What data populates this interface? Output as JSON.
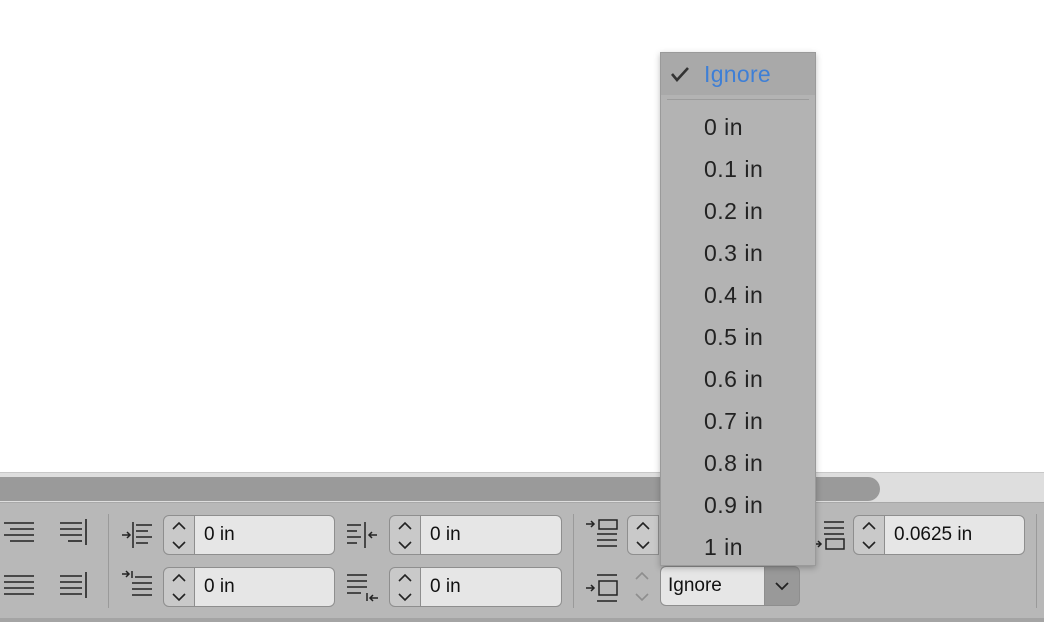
{
  "paragraph_panel": {
    "left_indent": {
      "value": "0 in"
    },
    "first_line_indent": {
      "value": "0 in"
    },
    "right_indent": {
      "value": "0 in"
    },
    "last_line_indent": {
      "value": "0 in"
    },
    "space_before": {
      "value": ""
    },
    "space_after": {
      "value": "0.0625 in"
    },
    "align_to_grid": {
      "value": "Ignore"
    }
  },
  "dropdown_menu": {
    "selected": "Ignore",
    "items": [
      "0 in",
      "0.1 in",
      "0.2 in",
      "0.3 in",
      "0.4 in",
      "0.5 in",
      "0.6 in",
      "0.7 in",
      "0.8 in",
      "0.9 in",
      "1 in"
    ]
  },
  "colors": {
    "accent": "#3e7fd6",
    "panel_bg": "#b8b8b8",
    "menu_bg": "#b3b3b3"
  },
  "icons": [
    "align-right-icon",
    "justify-all-icon",
    "justify-last-right-icon",
    "left-indent-icon",
    "first-line-indent-icon",
    "right-indent-icon",
    "last-line-indent-icon",
    "space-before-icon",
    "space-after-icon",
    "drop-cap-icon",
    "checkmark-icon",
    "chevron-up-icon",
    "chevron-down-icon"
  ]
}
